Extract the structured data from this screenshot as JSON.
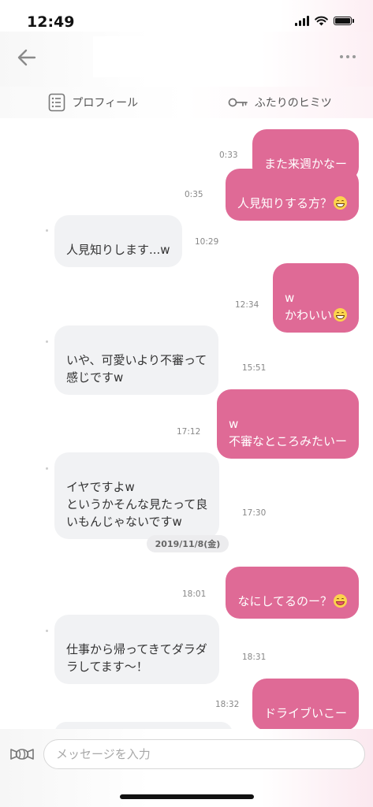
{
  "status": {
    "time": "12:49"
  },
  "tabs": [
    {
      "label": "プロフィール",
      "icon": "profile-list-icon"
    },
    {
      "label": "ふたりのヒミツ",
      "icon": "key-icon"
    }
  ],
  "messages": [
    {
      "side": "sent",
      "text": "また来週かなー",
      "time": "0:33",
      "emoji": ""
    },
    {
      "side": "sent",
      "text": "人見知りする方？",
      "time": "0:35",
      "emoji": "grinning-face"
    },
    {
      "side": "received",
      "text": "人見知りします...w",
      "time": "10:29",
      "emoji": ""
    },
    {
      "side": "sent",
      "text": "w\nかわいい",
      "time": "12:34",
      "emoji": "grinning-face"
    },
    {
      "side": "received",
      "text": "いや、可愛いより不審って\n感じですw",
      "time": "15:51",
      "emoji": ""
    },
    {
      "side": "sent",
      "text": "w\n不審なところみたいー",
      "time": "17:12",
      "emoji": ""
    },
    {
      "side": "received",
      "text": "イヤですよw\nというかそんな見たって良\nいもんじゃないですw",
      "time": "17:30",
      "emoji": ""
    },
    {
      "side": "sent",
      "text": "なにしてるのー？",
      "time": "18:01",
      "emoji": "winking-tongue-face"
    },
    {
      "side": "received",
      "text": "仕事から帰ってきてダラダ\nラしてます〜！",
      "time": "18:31",
      "emoji": ""
    },
    {
      "side": "sent",
      "text": "ドライブいこー",
      "time": "18:32",
      "emoji": ""
    }
  ],
  "date_separator": "2019/11/8(金)",
  "input": {
    "placeholder": "メッセージを入力",
    "value": ""
  },
  "colors": {
    "sent_bubble": "#df6a96",
    "received_bubble": "#f1f2f4"
  }
}
